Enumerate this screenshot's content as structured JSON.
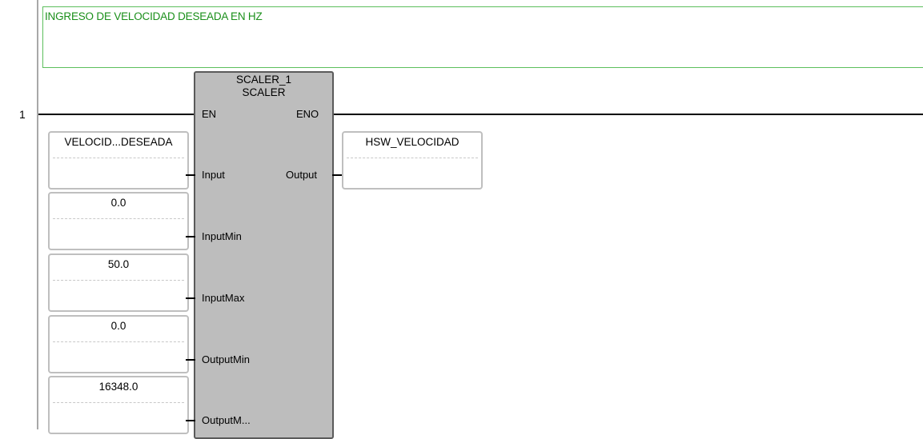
{
  "rung": {
    "number": "1",
    "comment": "INGRESO DE VELOCIDAD DESEADA EN HZ"
  },
  "block": {
    "instance": "SCALER_1",
    "type": "SCALER",
    "en_label": "EN",
    "eno_label": "ENO",
    "inputs": [
      {
        "pin": "Input",
        "operand": "VELOCID...DESEADA"
      },
      {
        "pin": "InputMin",
        "operand": "0.0"
      },
      {
        "pin": "InputMax",
        "operand": "50.0"
      },
      {
        "pin": "OutputMin",
        "operand": "0.0"
      },
      {
        "pin": "OutputM...",
        "operand": "16348.0"
      }
    ],
    "output": {
      "pin": "Output",
      "operand": "HSW_VELOCIDAD"
    }
  },
  "colors": {
    "comment_border": "#5cbf5c",
    "comment_text": "#1a8f1a",
    "block_fill": "#bdbdbd"
  }
}
